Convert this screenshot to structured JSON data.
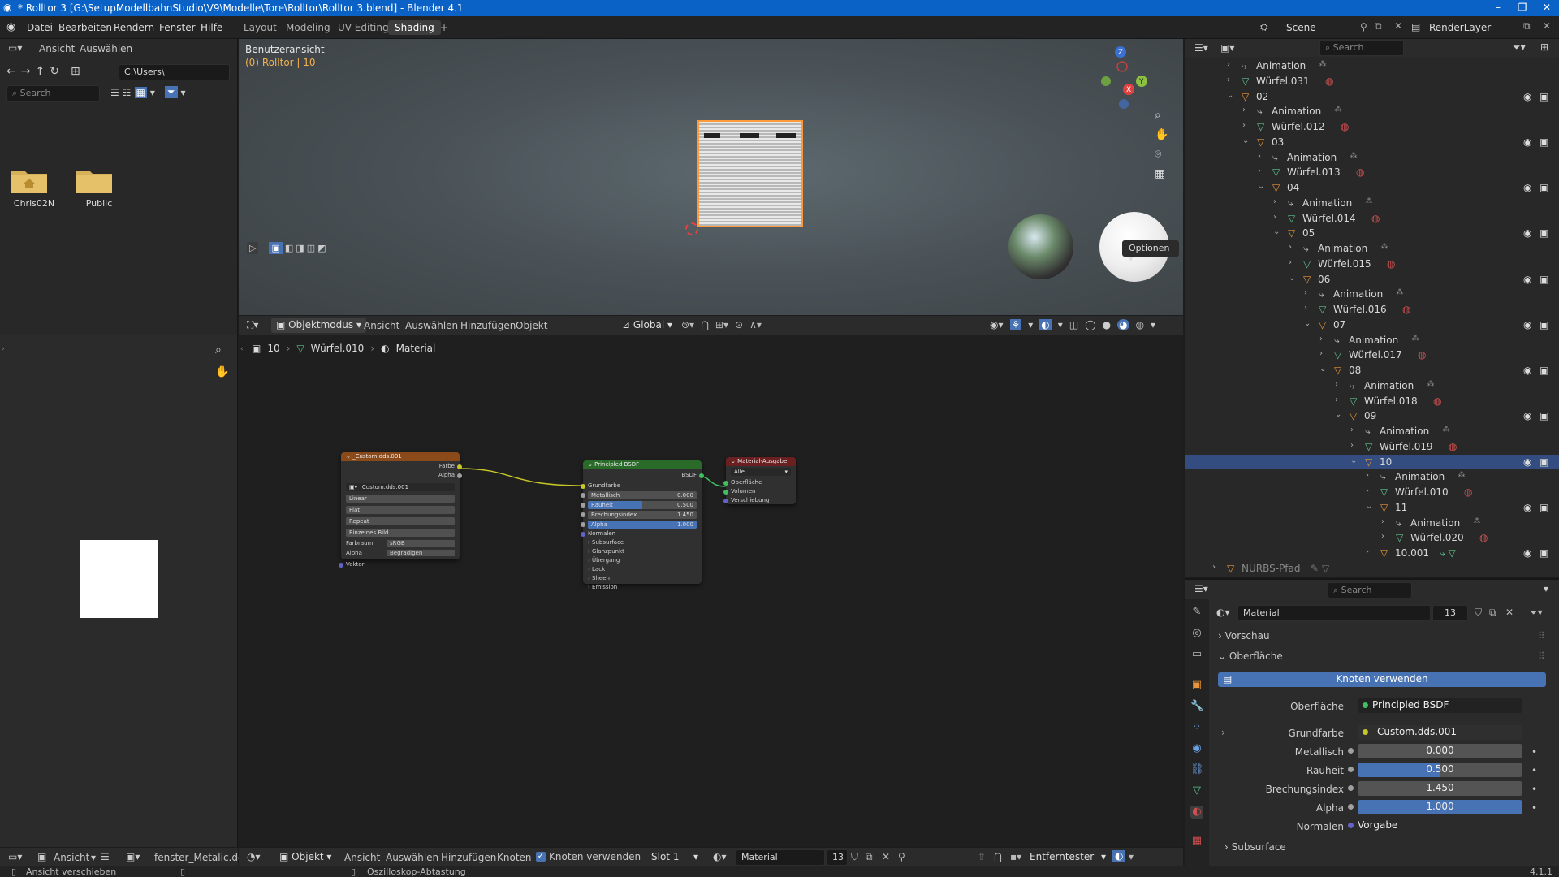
{
  "window": {
    "title": "* Rolltor 3 [G:\\SetupModellbahnStudio\\V9\\Modelle\\Tore\\Rolltor\\Rolltor 3.blend] - Blender 4.1",
    "minimize": "–",
    "maximize": "❐",
    "close": "✕"
  },
  "menu": {
    "datei": "Datei",
    "bearbeiten": "Bearbeiten",
    "rendern": "Rendern",
    "fenster": "Fenster",
    "hilfe": "Hilfe"
  },
  "workspaces": [
    "Layout",
    "Modeling",
    "UV Editing",
    "Shading",
    "+"
  ],
  "scene": {
    "name": "Scene",
    "renderlayer": "RenderLayer"
  },
  "filebrowser": {
    "menu_ansicht": "Ansicht",
    "menu_auswaehlen": "Auswählen",
    "path": "C:\\Users\\",
    "search_placeholder": "Search",
    "folders": [
      "Chris02N",
      "Public"
    ]
  },
  "viewport": {
    "view_name": "Benutzeransicht",
    "object_info": "(0) Rolltor | 10",
    "optionen": "Optionen",
    "mode": "Objektmodus",
    "menu_ansicht": "Ansicht",
    "menu_auswaehlen": "Auswählen",
    "menu_hinzufuegen": "Hinzufügen",
    "menu_objekt": "Objekt",
    "transform": "Global",
    "gizmo": {
      "z": "Z",
      "y": "Y",
      "x": "X"
    }
  },
  "node_editor": {
    "breadcrumb": [
      "10",
      "Würfel.010",
      "Material"
    ],
    "image_node": {
      "title": "_Custom.dds.001",
      "out_farbe": "Farbe",
      "out_alpha": "Alpha",
      "image_name": "_Custom.dds.001",
      "interpolation": "Linear",
      "projection": "Flat",
      "extension": "Repeat",
      "source": "Einzelnes Bild",
      "farbraum_label": "Farbraum",
      "farbraum_value": "sRGB",
      "alpha_label": "Alpha",
      "alpha_value": "Begradigen",
      "in_vektor": "Vektor"
    },
    "bsdf_node": {
      "title": "Principled BSDF",
      "out_bsdf": "BSDF",
      "grundfarbe": "Grundfarbe",
      "metallisch_label": "Metallisch",
      "metallisch_value": "0.000",
      "rauheit_label": "Rauheit",
      "rauheit_value": "0.500",
      "brechung_label": "Brechungsindex",
      "brechung_value": "1.450",
      "alpha_label": "Alpha",
      "alpha_value": "1.000",
      "normalen": "Normalen",
      "panels": [
        "Subsurface",
        "Glanzpunkt",
        "Übergang",
        "Lack",
        "Sheen",
        "Emission"
      ]
    },
    "output_node": {
      "title": "Material-Ausgabe",
      "target": "Alle",
      "oberflaeche": "Oberfläche",
      "volumen": "Volumen",
      "verschiebung": "Verschiebung"
    },
    "footer": {
      "objekt": "Objekt",
      "ansicht": "Ansicht",
      "auswaehlen": "Auswählen",
      "hinzufuegen": "Hinzufügen",
      "knoten": "Knoten",
      "knoten_verwenden": "Knoten verwenden",
      "slot": "Slot 1",
      "material": "Material",
      "users": "13",
      "snap": "Entferntester"
    }
  },
  "image_editor": {
    "ansicht": "Ansicht",
    "image_name": "fenster_Metalic.dds"
  },
  "outliner": {
    "search_placeholder": "Search",
    "rows": [
      {
        "label": "Animation",
        "type": "anim",
        "indent": 0
      },
      {
        "label": "Würfel.031",
        "type": "mesh",
        "indent": 0
      },
      {
        "label": "02",
        "type": "empty",
        "indent": 0,
        "open": true
      },
      {
        "label": "Animation",
        "type": "anim",
        "indent": 1
      },
      {
        "label": "Würfel.012",
        "type": "mesh",
        "indent": 1
      },
      {
        "label": "03",
        "type": "empty",
        "indent": 1,
        "open": true
      },
      {
        "label": "Animation",
        "type": "anim",
        "indent": 2
      },
      {
        "label": "Würfel.013",
        "type": "mesh",
        "indent": 2
      },
      {
        "label": "04",
        "type": "empty",
        "indent": 2,
        "open": true
      },
      {
        "label": "Animation",
        "type": "anim",
        "indent": 3
      },
      {
        "label": "Würfel.014",
        "type": "mesh",
        "indent": 3
      },
      {
        "label": "05",
        "type": "empty",
        "indent": 3,
        "open": true
      },
      {
        "label": "Animation",
        "type": "anim",
        "indent": 4
      },
      {
        "label": "Würfel.015",
        "type": "mesh",
        "indent": 4
      },
      {
        "label": "06",
        "type": "empty",
        "indent": 4,
        "open": true
      },
      {
        "label": "Animation",
        "type": "anim",
        "indent": 5
      },
      {
        "label": "Würfel.016",
        "type": "mesh",
        "indent": 5
      },
      {
        "label": "07",
        "type": "empty",
        "indent": 5,
        "open": true
      },
      {
        "label": "Animation",
        "type": "anim",
        "indent": 6
      },
      {
        "label": "Würfel.017",
        "type": "mesh",
        "indent": 6
      },
      {
        "label": "08",
        "type": "empty",
        "indent": 6,
        "open": true
      },
      {
        "label": "Animation",
        "type": "anim",
        "indent": 7
      },
      {
        "label": "Würfel.018",
        "type": "mesh",
        "indent": 7
      },
      {
        "label": "09",
        "type": "empty",
        "indent": 7,
        "open": true
      },
      {
        "label": "Animation",
        "type": "anim",
        "indent": 8
      },
      {
        "label": "Würfel.019",
        "type": "mesh",
        "indent": 8
      },
      {
        "label": "10",
        "type": "empty",
        "indent": 8,
        "open": true,
        "selected": true
      },
      {
        "label": "Animation",
        "type": "anim",
        "indent": 9
      },
      {
        "label": "Würfel.010",
        "type": "mesh",
        "indent": 9
      },
      {
        "label": "11",
        "type": "empty",
        "indent": 9,
        "open": true
      },
      {
        "label": "Animation",
        "type": "anim",
        "indent": 10
      },
      {
        "label": "Würfel.020",
        "type": "mesh",
        "indent": 10
      },
      {
        "label": "10.001",
        "type": "empty",
        "indent": 9
      },
      {
        "label": "NURBS-Pfad",
        "type": "curve",
        "indent": -1
      }
    ]
  },
  "properties": {
    "search_placeholder": "Search",
    "material_name": "Material",
    "users": "13",
    "vorschau": "Vorschau",
    "oberflaeche_panel": "Oberfläche",
    "knoten_verwenden": "Knoten verwenden",
    "oberflaeche_label": "Oberfläche",
    "oberflaeche_value": "Principled BSDF",
    "grundfarbe_label": "Grundfarbe",
    "grundfarbe_value": "_Custom.dds.001",
    "metallisch_label": "Metallisch",
    "metallisch_value": "0.000",
    "metallisch_fill": 0.0,
    "rauheit_label": "Rauheit",
    "rauheit_value": "0.500",
    "rauheit_fill": 0.5,
    "brechung_label": "Brechungsindex",
    "brechung_value": "1.450",
    "alpha_label": "Alpha",
    "alpha_value": "1.000",
    "alpha_fill": 1.0,
    "normalen_label": "Normalen",
    "normalen_value": "Vorgabe",
    "subsurface": "Subsurface"
  },
  "status": {
    "left": "Ansicht verschieben",
    "middle": "Oszilloskop-Abtastung",
    "version": "4.1.1"
  },
  "colors": {
    "title_blue": "#0a62c6",
    "accent_blue": "#4772b3",
    "selection": "#334d80",
    "empty_orange": "#e8943a",
    "mesh_green": "#5fc28e",
    "material_red": "#d05050",
    "image_node_header": "#8a4a1a",
    "bsdf_node_header": "#2a6b2a",
    "output_node_header": "#6a2020"
  }
}
